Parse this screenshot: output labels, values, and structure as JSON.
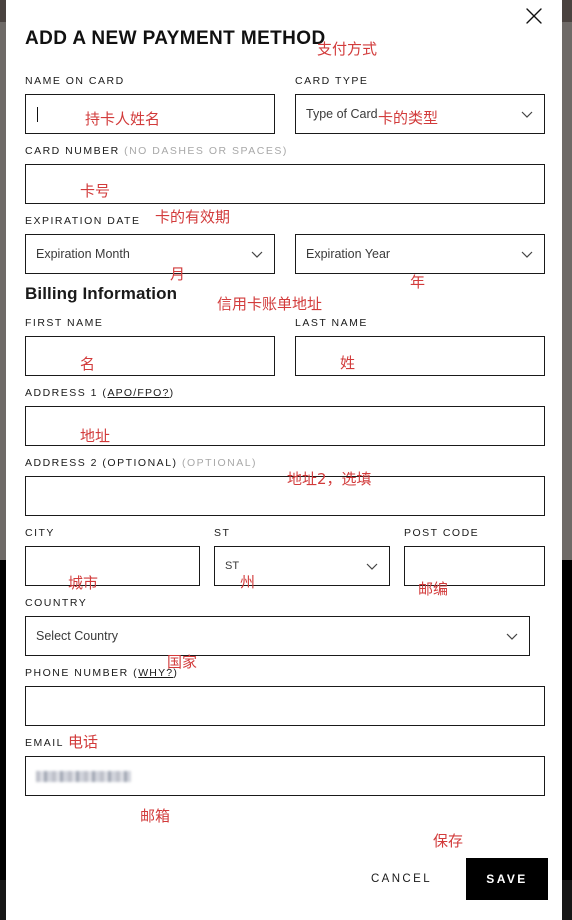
{
  "window": {
    "title": "ADD A NEW PAYMENT METHOD",
    "close_icon": "close-icon"
  },
  "annotations": {
    "title": "支付方式",
    "name_on_card": "持卡人姓名",
    "card_type": "卡的类型",
    "card_number": "卡号",
    "expiration_date": "卡的有效期",
    "expiration_month": "月",
    "expiration_year": "年",
    "billing_information": "信用卡账单地址",
    "first_name": "名",
    "last_name": "姓",
    "address1": "地址",
    "address2": "地址2，选填",
    "city": "城市",
    "state": "州",
    "post_code": "邮编",
    "country": "国家",
    "phone": "电话",
    "email": "邮箱",
    "save": "保存"
  },
  "card_section": {
    "name_on_card": {
      "label": "NAME ON CARD",
      "value": "",
      "focused": true
    },
    "card_type": {
      "label": "CARD TYPE",
      "selected": "Type of Card"
    },
    "card_number": {
      "label": "CARD NUMBER",
      "hint": "(NO DASHES OR SPACES)",
      "value": ""
    },
    "expiration": {
      "label": "EXPIRATION DATE",
      "month_selected": "Expiration Month",
      "year_selected": "Expiration Year"
    }
  },
  "billing": {
    "heading": "Billing Information",
    "first_name": {
      "label": "FIRST NAME",
      "value": ""
    },
    "last_name": {
      "label": "LAST NAME",
      "value": ""
    },
    "address1": {
      "label_main": "ADDRESS 1 (",
      "label_link": "APO/FPO?",
      "label_end": ")",
      "value": ""
    },
    "address2": {
      "label": "ADDRESS 2 (OPTIONAL)",
      "hint": "(OPTIONAL)",
      "value": ""
    },
    "city": {
      "label": "CITY",
      "value": ""
    },
    "state": {
      "label": "ST",
      "selected": "ST"
    },
    "post_code": {
      "label": "POST CODE",
      "value": ""
    },
    "country": {
      "label": "COUNTRY",
      "selected": "Select Country"
    },
    "phone": {
      "label_main": "PHONE NUMBER (",
      "label_link": "WHY?",
      "label_end": ")",
      "value": ""
    },
    "email": {
      "label": "EMAIL",
      "value": "",
      "redacted": true
    }
  },
  "footer": {
    "cancel_label": "CANCEL",
    "save_label": "SAVE"
  },
  "colors": {
    "annotation_red": "#d23b3b",
    "text": "#1a1a1a",
    "hint_gray": "#a8a8a8",
    "border": "#1a1a1a",
    "save_bg": "#000000"
  }
}
